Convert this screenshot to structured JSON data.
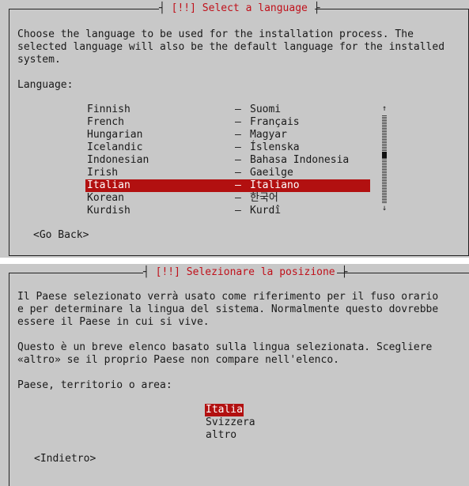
{
  "colors": {
    "dialog_bg": "#c8c8c8",
    "title": "#c0101a",
    "selection_bg": "#b21010",
    "selection_fg": "#ffffff",
    "text": "#1a1a1a"
  },
  "language_dialog": {
    "title_prefix": "[!!]",
    "title_text": "Select a language",
    "intro": "Choose the language to be used for the installation process. The\nselected language will also be the default language for the installed\nsystem.",
    "list_label": "Language:",
    "languages": [
      {
        "english": "Finnish",
        "dash": "–",
        "native": "Suomi"
      },
      {
        "english": "French",
        "dash": "–",
        "native": "Français"
      },
      {
        "english": "Hungarian",
        "dash": "–",
        "native": "Magyar"
      },
      {
        "english": "Icelandic",
        "dash": "–",
        "native": "Íslenska"
      },
      {
        "english": "Indonesian",
        "dash": "–",
        "native": "Bahasa Indonesia"
      },
      {
        "english": "Irish",
        "dash": "–",
        "native": "Gaeilge"
      },
      {
        "english": "Italian",
        "dash": "–",
        "native": "Italiano"
      },
      {
        "english": "Korean",
        "dash": "–",
        "native": "한국어"
      },
      {
        "english": "Kurdish",
        "dash": "–",
        "native": "Kurdî"
      }
    ],
    "selected_index": 6,
    "scroll_up_icon": "↑",
    "scroll_down_icon": "↓",
    "back_button": "<Go Back>"
  },
  "location_dialog": {
    "title_prefix": "[!!]",
    "title_text": "Selezionare la posizione",
    "intro": "Il Paese selezionato verrà usato come riferimento per il fuso orario\ne per determinare la lingua del sistema. Normalmente questo dovrebbe\nessere il Paese in cui si vive.",
    "intro2": "Questo è un breve elenco basato sulla lingua selezionata. Scegliere\n«altro» se il proprio Paese non compare nell'elenco.",
    "list_label": "Paese, territorio o area:",
    "countries": [
      "Italia",
      "Svizzera",
      "altro"
    ],
    "selected_index": 0,
    "back_button": "<Indietro>"
  }
}
